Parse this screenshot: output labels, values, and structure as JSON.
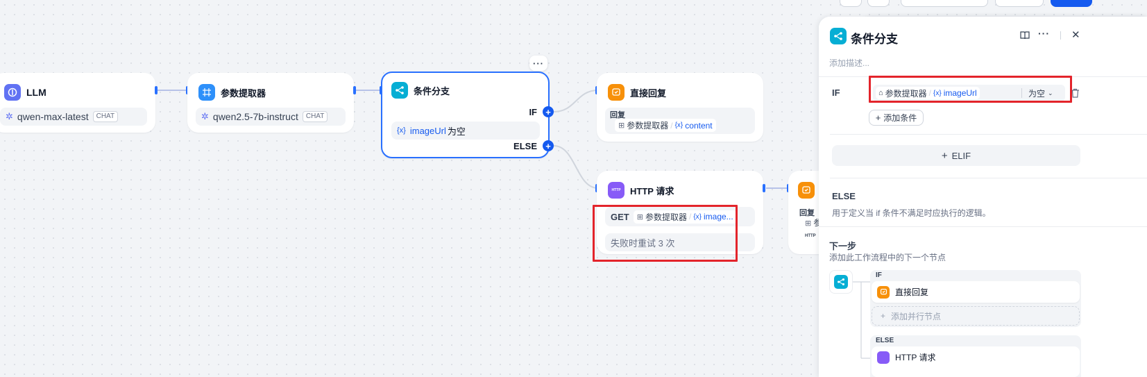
{
  "canvas": {
    "llm_node": {
      "title": "LLM",
      "model": "qwen-max-latest",
      "mode": "CHAT"
    },
    "param_node": {
      "title": "参数提取器",
      "model": "qwen2.5-7b-instruct",
      "mode": "CHAT"
    },
    "branch_node": {
      "title": "条件分支",
      "more": "···",
      "if_label": "IF",
      "else_label": "ELSE",
      "condition": {
        "var_symbol": "{x}",
        "var": "imageUrl",
        "op": "为空"
      }
    },
    "answer_node": {
      "title": "直接回复",
      "label": "回复",
      "source": "参数提取器",
      "sep": "/",
      "var_symbol": "{x}",
      "var": "content"
    },
    "http_node": {
      "title": "HTTP 请求",
      "icon_text": "HTTP",
      "method": "GET",
      "source": "参数提取器",
      "sep": "/",
      "var_symbol": "{x}",
      "var": "image...",
      "retry": "失败时重试 3 次"
    },
    "partial_node": {
      "label": "回复",
      "row1": "参",
      "row2_icon": "HTTP",
      "row2": "H"
    }
  },
  "panel": {
    "title": "条件分支",
    "description_placeholder": "添加描述...",
    "if_label": "IF",
    "condition": {
      "source": "参数提取器",
      "sep": "/",
      "var_symbol": "{x}",
      "var": "imageUrl",
      "op": "为空"
    },
    "add_condition": "添加条件",
    "elif_button": "ELIF",
    "else_title": "ELSE",
    "else_desc": "用于定义当 if 条件不满足时应执行的逻辑。",
    "next_title": "下一步",
    "next_desc": "添加此工作流程中的下一个节点",
    "next_if_label": "IF",
    "next_if_node": "直接回复",
    "add_parallel": "添加并行节点",
    "next_else_label": "ELSE",
    "next_else_node": "HTTP 请求"
  },
  "colors": {
    "accent": "#155aef",
    "selected_border": "#2970ff",
    "highlight_red": "#e3242b",
    "llm_icon": "#6172f3",
    "param_icon": "#2e90fa",
    "branch_icon": "#06aed4",
    "answer_icon": "#f79009",
    "http_icon": "#875bf7"
  },
  "icons": [
    "brain-icon",
    "grid-icon",
    "branch-icon",
    "reply-icon",
    "http-icon",
    "book-icon",
    "more-icon",
    "close-icon",
    "trash-icon",
    "plus-icon",
    "chevron-down-icon",
    "home-icon"
  ]
}
